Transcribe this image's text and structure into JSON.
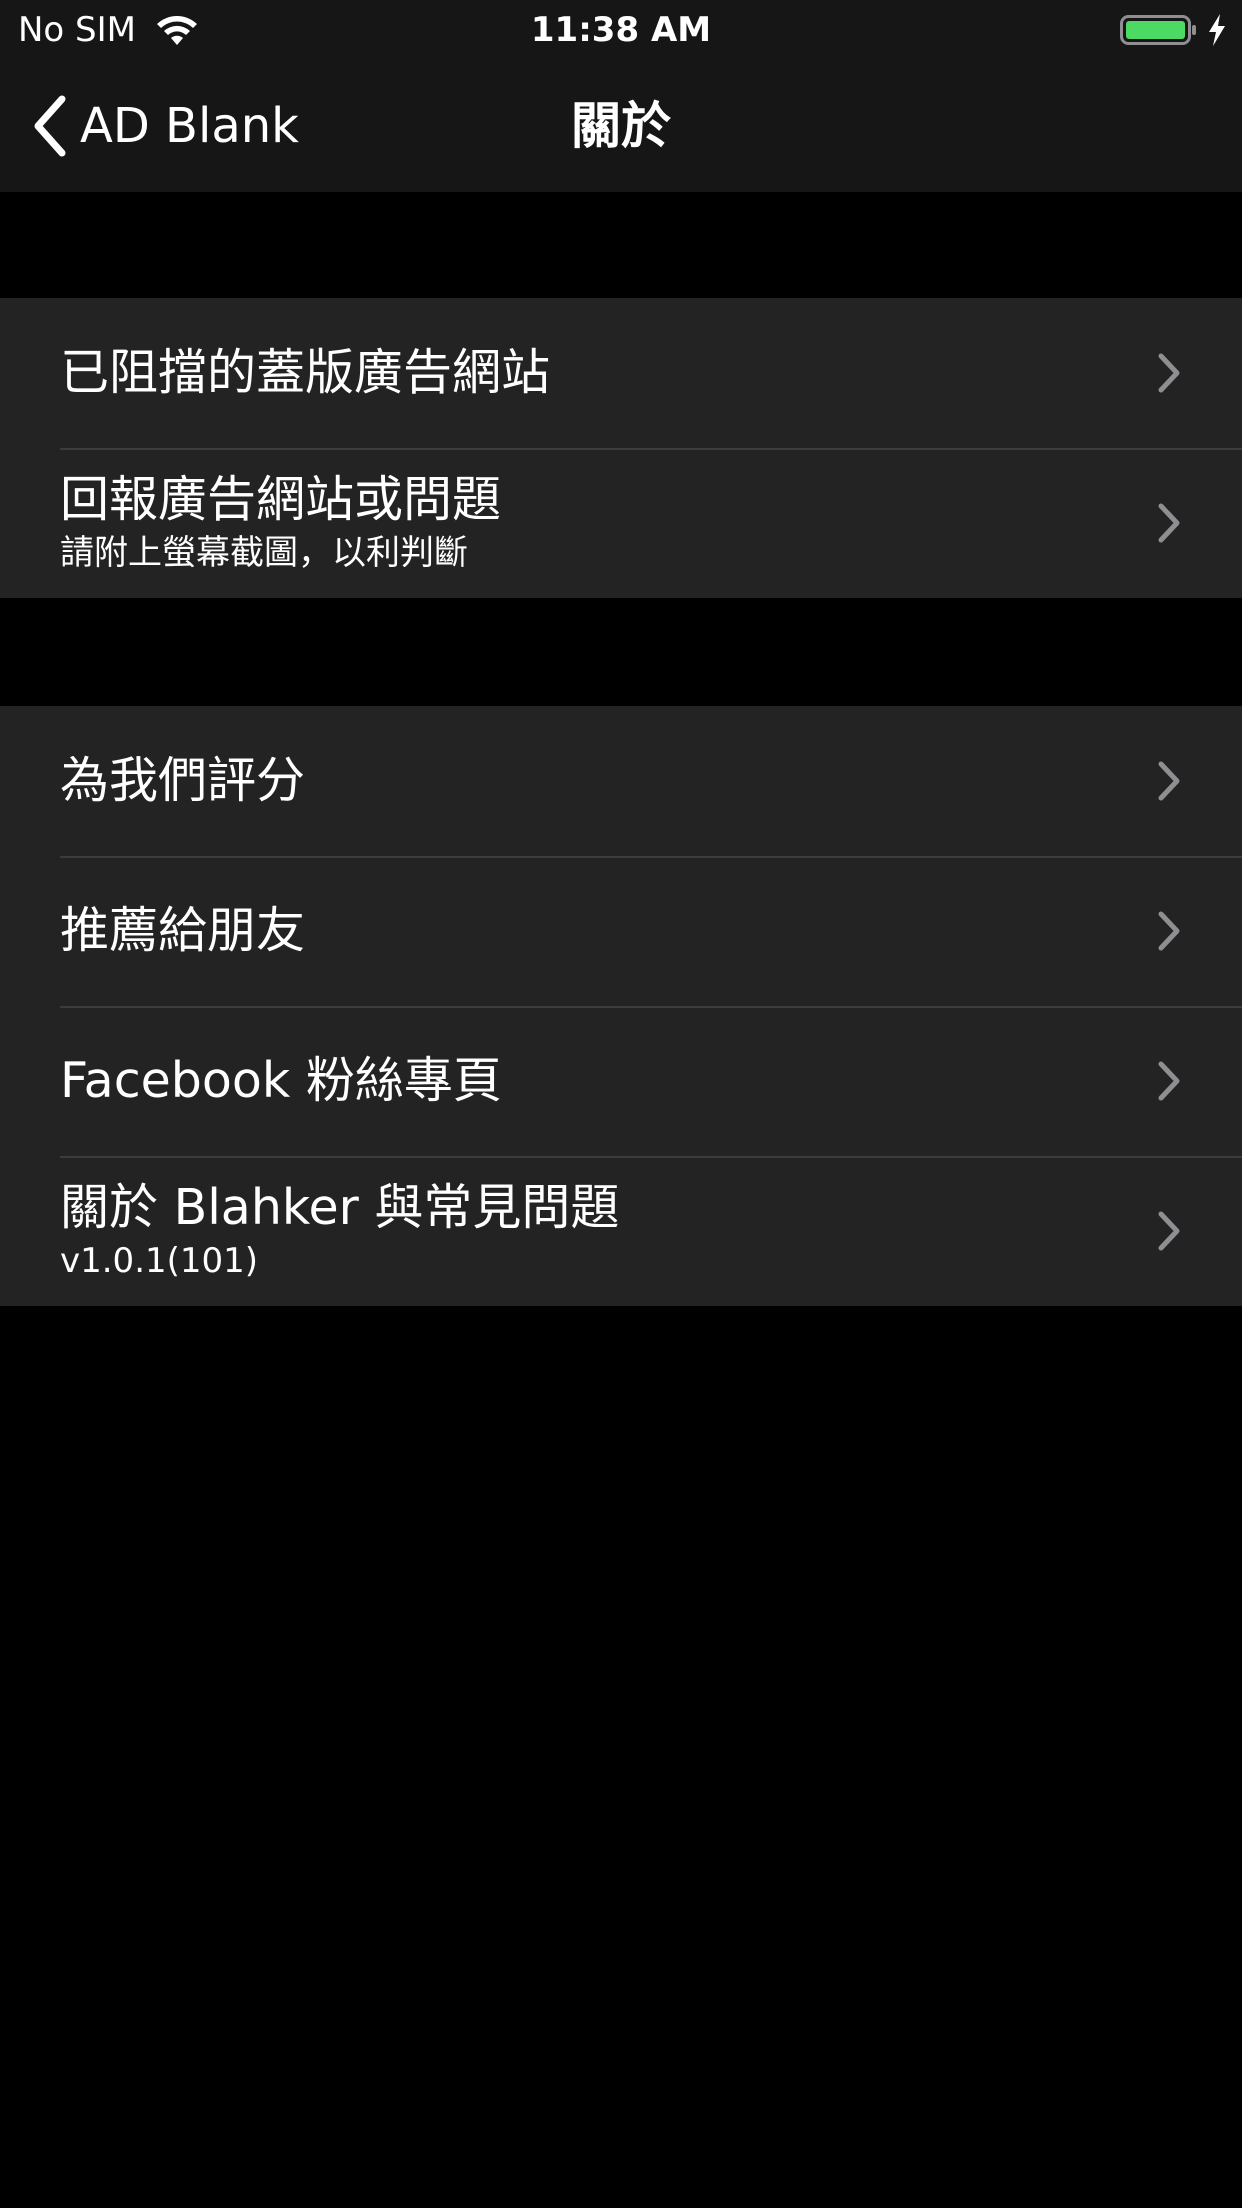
{
  "status_bar": {
    "carrier": "No SIM",
    "time": "11:38 AM",
    "battery_color": "#4CD964",
    "icons": [
      "wifi-icon",
      "battery-icon",
      "charging-icon"
    ]
  },
  "nav": {
    "back_label": "AD Blank",
    "title": "關於"
  },
  "sections": [
    {
      "rows": [
        {
          "title": "已阻擋的蓋版廣告網站"
        },
        {
          "title": "回報廣告網站或問題",
          "subtitle": "請附上螢幕截圖，以利判斷"
        }
      ]
    },
    {
      "rows": [
        {
          "title": "為我們評分"
        },
        {
          "title": "推薦給朋友"
        },
        {
          "title": "Facebook 粉絲專頁"
        },
        {
          "title": "關於 Blahker 與常見問題",
          "subtitle": "v1.0.1(101)"
        }
      ]
    }
  ],
  "colors": {
    "background": "#000000",
    "bar_background": "#161616",
    "cell_background": "#232323",
    "separator": "#3C3C3C",
    "chevron": "#8E8E93"
  }
}
